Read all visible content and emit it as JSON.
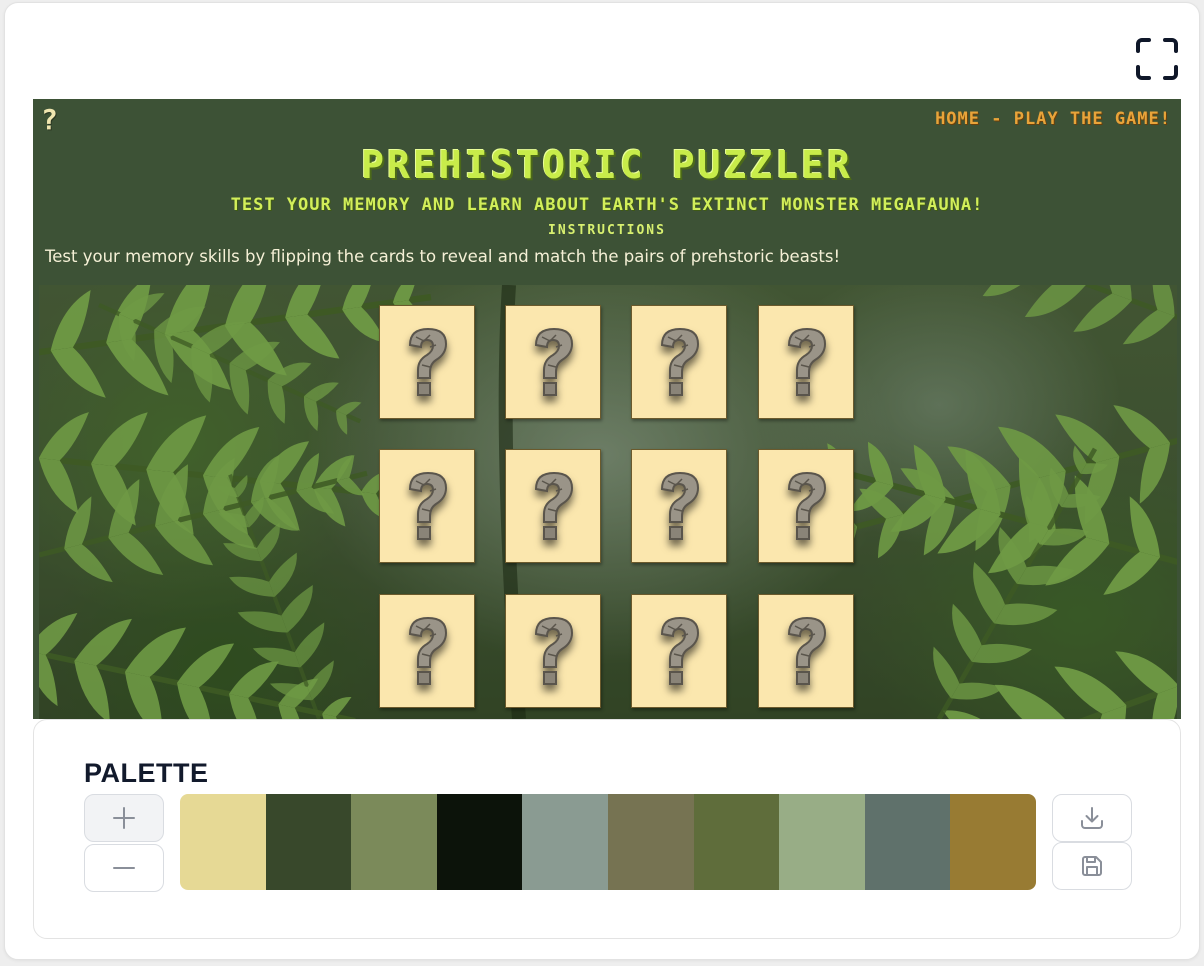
{
  "toolbar": {
    "fullscreen_icon": "expand-corners-icon"
  },
  "game": {
    "help_icon": "?",
    "nav": "HOME - PLAY THE GAME!",
    "title": "PREHISTORIC PUZZLER",
    "subtitle": "TEST YOUR MEMORY AND LEARN ABOUT EARTH'S EXTINCT MONSTER MEGAFAUNA!",
    "instructions_heading": "INSTRUCTIONS",
    "instructions_text": "Test your memory skills by flipping the cards to reveal and match the pairs of prehstoric beasts!",
    "background": "jungle-ferns",
    "card_face": "stone-question-mark-icon",
    "card_count": 12,
    "colors": {
      "header_bg": "#3d5236",
      "title": "#c8ec4a",
      "nav": "#e8a43a",
      "card": "#fbe7ae"
    }
  },
  "palette": {
    "title": "PALETTE",
    "add_icon": "plus-icon",
    "remove_icon": "minus-icon",
    "download_icon": "download-icon",
    "save_icon": "save-icon",
    "colors": [
      "#e6d995",
      "#38482b",
      "#7b8a5a",
      "#0c130a",
      "#8a9b92",
      "#767352",
      "#5f6d3b",
      "#98ad86",
      "#5f716b",
      "#987b33"
    ]
  }
}
